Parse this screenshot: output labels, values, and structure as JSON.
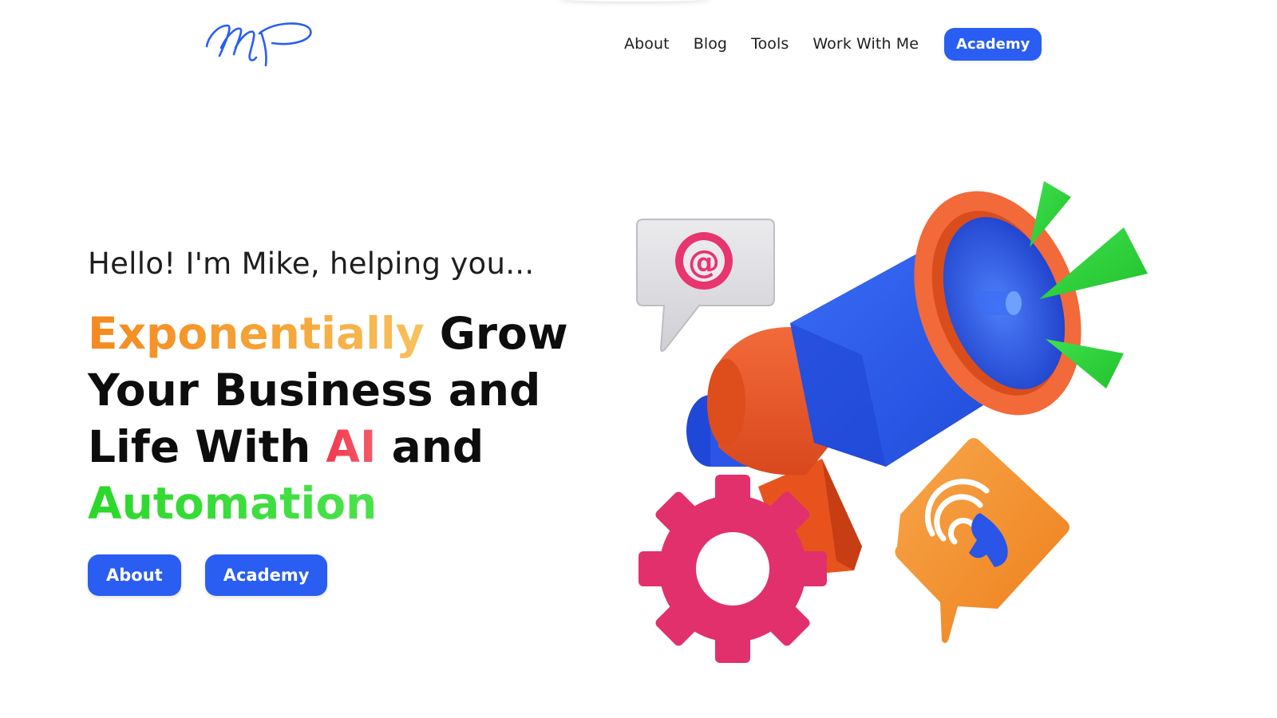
{
  "brand": {
    "logo_text": "MP",
    "logo_color": "#2a5df2"
  },
  "nav": {
    "links": [
      {
        "label": "About"
      },
      {
        "label": "Blog"
      },
      {
        "label": "Tools"
      },
      {
        "label": "Work With Me"
      }
    ],
    "cta_label": "Academy"
  },
  "hero": {
    "intro": "Hello! I'm Mike, helping you...",
    "headline": {
      "part1_highlight": "Exponentially",
      "part2": " Grow",
      "part3": "Your Business and",
      "part4": "Life With ",
      "part5_highlight": "AI",
      "part6": " and",
      "part7_highlight": "Automation"
    },
    "buttons": {
      "about_label": "About",
      "academy_label": "Academy"
    }
  },
  "colors": {
    "accent_blue": "#2a5df2",
    "highlight_orange": "#f5891f",
    "highlight_red": "#f2394f",
    "highlight_green": "#2ad82a",
    "text_dark": "#0d0d0d"
  },
  "illustration": {
    "icons": [
      "megaphone-icon",
      "email-at-icon",
      "phone-call-icon",
      "gear-icon"
    ]
  }
}
